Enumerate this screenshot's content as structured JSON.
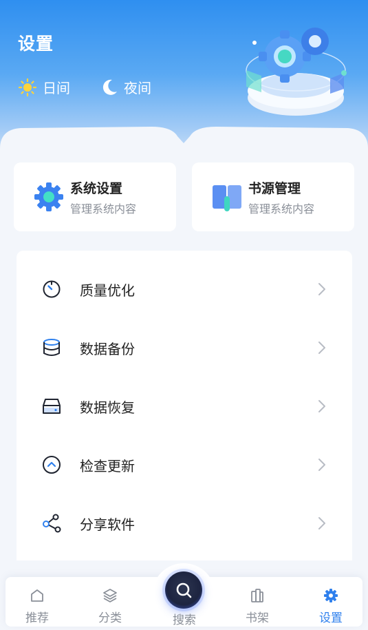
{
  "header": {
    "title": "设置",
    "modes": [
      {
        "label": "日间",
        "icon": "sun-icon"
      },
      {
        "label": "夜间",
        "icon": "moon-icon"
      }
    ]
  },
  "cards": [
    {
      "title": "系统设置",
      "subtitle": "管理系统内容",
      "icon": "gear-icon"
    },
    {
      "title": "书源管理",
      "subtitle": "管理系统内容",
      "icon": "book-icon"
    }
  ],
  "menu": [
    {
      "label": "质量优化",
      "icon": "timer-icon"
    },
    {
      "label": "数据备份",
      "icon": "database-icon"
    },
    {
      "label": "数据恢复",
      "icon": "drive-icon"
    },
    {
      "label": "检查更新",
      "icon": "chevron-up-circle-icon"
    },
    {
      "label": "分享软件",
      "icon": "share-icon"
    }
  ],
  "tabbar": {
    "items": [
      {
        "label": "推荐",
        "icon": "home-icon"
      },
      {
        "label": "分类",
        "icon": "layers-icon"
      },
      {
        "label": "搜索",
        "icon": "search-icon"
      },
      {
        "label": "书架",
        "icon": "bookshelf-icon"
      },
      {
        "label": "设置",
        "icon": "gear-icon",
        "active": true
      }
    ]
  },
  "colors": {
    "accent": "#2f80ed",
    "hero_top": "#2f8ff0",
    "text_primary": "#222222",
    "text_secondary": "#8a8f98"
  }
}
